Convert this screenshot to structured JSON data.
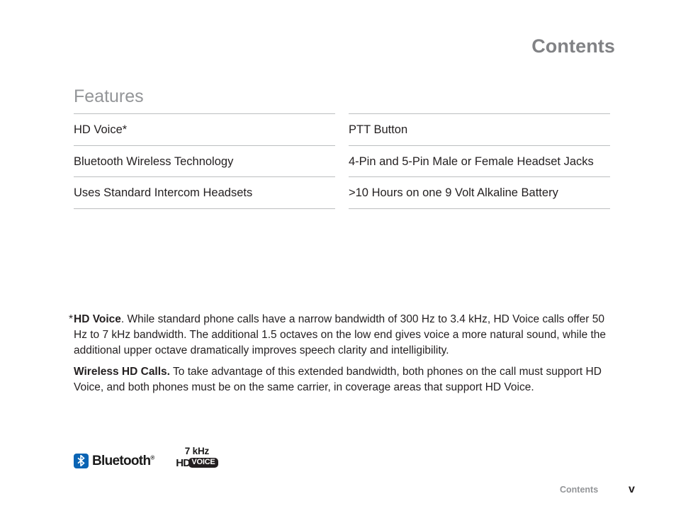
{
  "page": {
    "background_color": "#ffffff",
    "running_head": "Contents"
  },
  "section": {
    "heading": "Features",
    "heading_color": "#939598",
    "rule_color": "#bcbec0"
  },
  "features": {
    "left_column": [
      "HD Voice*",
      "Bluetooth Wireless Technology",
      "Uses Standard Intercom Headsets"
    ],
    "right_column": [
      "PTT Button",
      "4-Pin and 5-Pin Male or Female Headset Jacks",
      ">10 Hours on one 9 Volt Alkaline Battery"
    ]
  },
  "notes": {
    "footnote": {
      "marker": "*",
      "term": "HD Voice",
      "body": ". While standard phone calls have a narrow bandwidth of 300 Hz to 3.4 kHz, HD Voice calls offer 50 Hz to 7 kHz bandwidth. The additional 1.5 octaves on the low end gives voice a more natural sound, while the additional upper octave dramatically improves speech clarity and intelligibility."
    },
    "wireless": {
      "term": "Wireless HD Calls.",
      "body": " To take advantage of this extended bandwidth, both phones on the call must support HD Voice, and both phones must be on the same carrier, in coverage areas that support HD Voice."
    }
  },
  "logos": {
    "bluetooth": {
      "wordmark": "Bluetooth",
      "registered": "®",
      "mark_color": "#0a64b4",
      "icon": "bluetooth-rune-icon"
    },
    "hd_voice": {
      "khz": "7 kHz",
      "hd": "HD",
      "voice": "VOICE",
      "badge_color": "#231f20"
    }
  },
  "footer": {
    "label": "Contents",
    "page_number": "v"
  }
}
